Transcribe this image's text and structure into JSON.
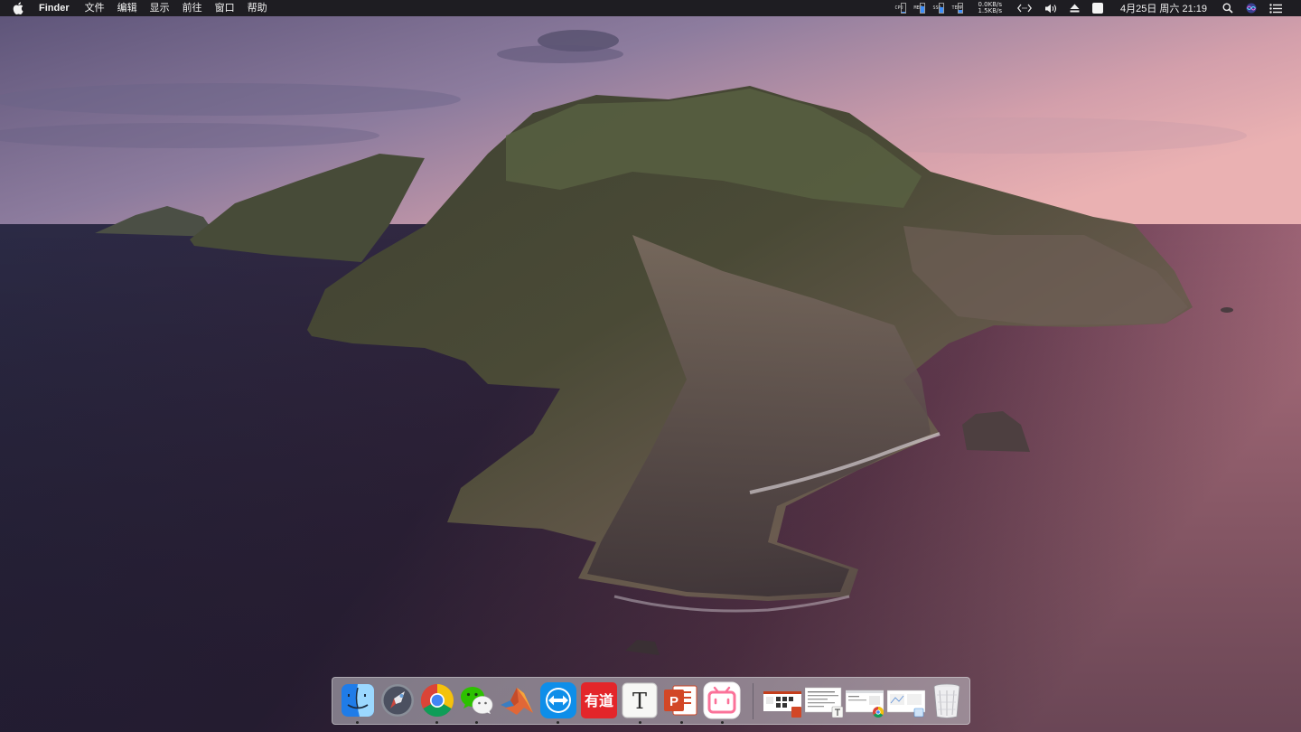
{
  "menubar": {
    "app_name": "Finder",
    "menus": [
      "文件",
      "编辑",
      "显示",
      "前往",
      "窗口",
      "帮助"
    ],
    "stats": [
      {
        "label": "CPU",
        "level": 0.1
      },
      {
        "label": "MEM",
        "level": 0.7
      },
      {
        "label": "SSD",
        "level": 0.6
      },
      {
        "label": "TEMP",
        "level": 0.3
      }
    ],
    "network": {
      "upload": "0.0KB/s",
      "download": "1.5KB/s"
    },
    "clock": "4月25日 周六 21:19",
    "icons": [
      "apple-icon",
      "code-brackets-icon",
      "volume-icon",
      "eject-icon",
      "window-icon",
      "spotlight-icon",
      "siri-icon",
      "notification-center-icon"
    ]
  },
  "dock": {
    "apps": [
      {
        "name": "finder",
        "running": true
      },
      {
        "name": "launchpad",
        "running": false
      },
      {
        "name": "chrome",
        "running": true
      },
      {
        "name": "wechat",
        "running": true
      },
      {
        "name": "matlab",
        "running": false
      },
      {
        "name": "teamviewer",
        "running": true
      },
      {
        "name": "youdao",
        "label": "有道",
        "running": false
      },
      {
        "name": "typora",
        "label": "T",
        "running": true
      },
      {
        "name": "powerpoint",
        "label": "P",
        "running": true
      },
      {
        "name": "bilibili",
        "running": true
      }
    ],
    "minimized_windows": [
      {
        "name": "powerpoint-window"
      },
      {
        "name": "typora-window"
      },
      {
        "name": "chrome-window"
      },
      {
        "name": "preview-window"
      }
    ],
    "trash": {
      "name": "trash"
    }
  },
  "colors": {
    "menubar_bg": "#1e1d22",
    "dock_bg": "#c8c6cd",
    "chrome_red": "#db4437",
    "chrome_yellow": "#f4c20d",
    "chrome_green": "#0f9d58",
    "chrome_blue": "#4285f4",
    "wechat_green": "#2dc100",
    "teamviewer_blue": "#0e8ee9",
    "youdao_red": "#e3262a",
    "powerpoint_orange": "#d24726",
    "bilibili_pink": "#fb7299"
  }
}
